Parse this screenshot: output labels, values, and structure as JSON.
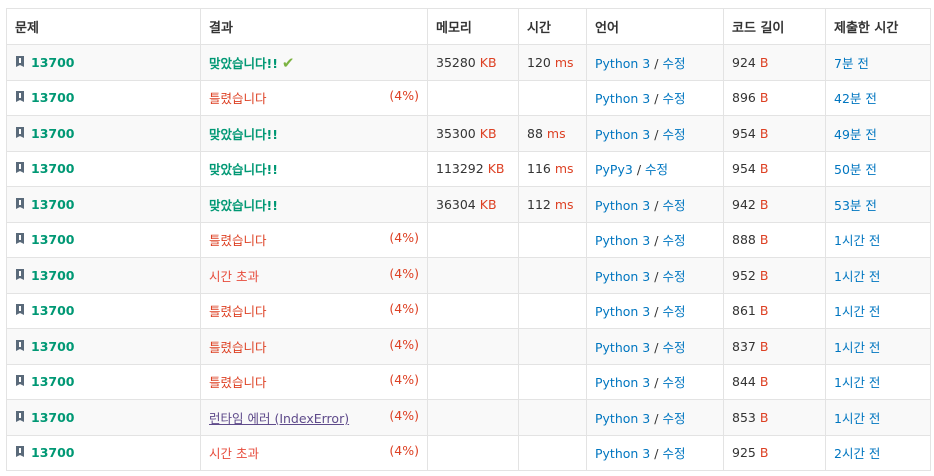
{
  "headers": {
    "problem": "문제",
    "result": "결과",
    "memory": "메모리",
    "time": "시간",
    "language": "언어",
    "code_length": "코드 길이",
    "submitted": "제출한 시간"
  },
  "edit_label": "수정",
  "units": {
    "memory": "KB",
    "time": "ms",
    "length": "B"
  },
  "colors": {
    "accepted": "#009874",
    "wrong": "#dd4124",
    "link": "#0076c0",
    "runtime": "#5f4b8b"
  },
  "rows": [
    {
      "problem": "13700",
      "result": "맞았습니다!!",
      "status": "ac",
      "check": "✔",
      "pct": "",
      "memory": "35280",
      "time": "120",
      "lang": "Python 3",
      "length": "924",
      "when": "7분 전"
    },
    {
      "problem": "13700",
      "result": "틀렸습니다",
      "status": "wa",
      "check": "",
      "pct": "(4%)",
      "memory": "",
      "time": "",
      "lang": "Python 3",
      "length": "896",
      "when": "42분 전"
    },
    {
      "problem": "13700",
      "result": "맞았습니다!!",
      "status": "ac",
      "check": "",
      "pct": "",
      "memory": "35300",
      "time": "88",
      "lang": "Python 3",
      "length": "954",
      "when": "49분 전"
    },
    {
      "problem": "13700",
      "result": "맞았습니다!!",
      "status": "ac",
      "check": "",
      "pct": "",
      "memory": "113292",
      "time": "116",
      "lang": "PyPy3",
      "length": "954",
      "when": "50분 전"
    },
    {
      "problem": "13700",
      "result": "맞았습니다!!",
      "status": "ac",
      "check": "",
      "pct": "",
      "memory": "36304",
      "time": "112",
      "lang": "Python 3",
      "length": "942",
      "when": "53분 전"
    },
    {
      "problem": "13700",
      "result": "틀렸습니다",
      "status": "wa",
      "check": "",
      "pct": "(4%)",
      "memory": "",
      "time": "",
      "lang": "Python 3",
      "length": "888",
      "when": "1시간 전"
    },
    {
      "problem": "13700",
      "result": "시간 초과",
      "status": "tle",
      "check": "",
      "pct": "(4%)",
      "memory": "",
      "time": "",
      "lang": "Python 3",
      "length": "952",
      "when": "1시간 전"
    },
    {
      "problem": "13700",
      "result": "틀렸습니다",
      "status": "wa",
      "check": "",
      "pct": "(4%)",
      "memory": "",
      "time": "",
      "lang": "Python 3",
      "length": "861",
      "when": "1시간 전"
    },
    {
      "problem": "13700",
      "result": "틀렸습니다",
      "status": "wa",
      "check": "",
      "pct": "(4%)",
      "memory": "",
      "time": "",
      "lang": "Python 3",
      "length": "837",
      "when": "1시간 전"
    },
    {
      "problem": "13700",
      "result": "틀렸습니다",
      "status": "wa",
      "check": "",
      "pct": "(4%)",
      "memory": "",
      "time": "",
      "lang": "Python 3",
      "length": "844",
      "when": "1시간 전"
    },
    {
      "problem": "13700",
      "result": "런타임 에러 (IndexError)",
      "status": "rte",
      "check": "",
      "pct": "(4%)",
      "memory": "",
      "time": "",
      "lang": "Python 3",
      "length": "853",
      "when": "1시간 전"
    },
    {
      "problem": "13700",
      "result": "시간 초과",
      "status": "tle",
      "check": "",
      "pct": "(4%)",
      "memory": "",
      "time": "",
      "lang": "Python 3",
      "length": "925",
      "when": "2시간 전"
    }
  ]
}
